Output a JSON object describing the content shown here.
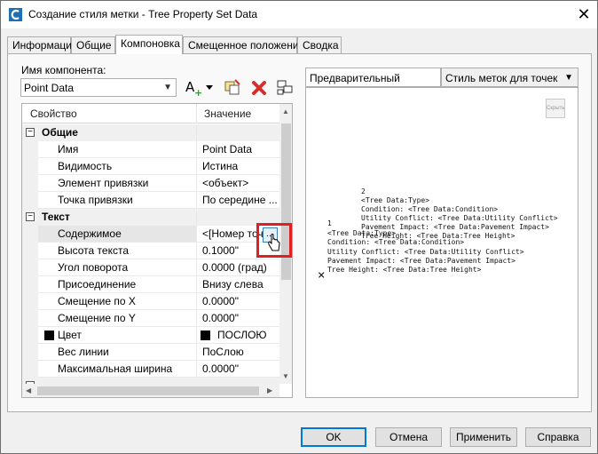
{
  "window": {
    "title": "Создание стиля метки - Tree Property Set Data",
    "close_symbol": "✕"
  },
  "tabs": [
    {
      "label": "Информация",
      "active": false
    },
    {
      "label": "Общие",
      "active": false
    },
    {
      "label": "Компоновка",
      "active": true
    },
    {
      "label": "Смещенное положение",
      "active": false
    },
    {
      "label": "Сводка",
      "active": false
    }
  ],
  "component": {
    "label": "Имя компонента:",
    "value": "Point Data"
  },
  "toolbar_icons": [
    "add-text-component-icon",
    "copy-component-icon",
    "delete-component-icon",
    "component-draw-order-icon"
  ],
  "grid": {
    "col_property": "Свойство",
    "col_value": "Значение",
    "rows": [
      {
        "kind": "category",
        "label": "Общие"
      },
      {
        "kind": "item",
        "label": "Имя",
        "value": "Point Data"
      },
      {
        "kind": "item",
        "label": "Видимость",
        "value": "Истина"
      },
      {
        "kind": "item",
        "label": "Элемент привязки",
        "value": "<объект>"
      },
      {
        "kind": "item",
        "label": "Точка привязки",
        "value": "По середине ..."
      },
      {
        "kind": "category",
        "label": "Текст"
      },
      {
        "kind": "item",
        "label": "Содержимое",
        "value": "<[Номер точ",
        "selected": true
      },
      {
        "kind": "item",
        "label": "Высота текста",
        "value": "0.1000\""
      },
      {
        "kind": "item",
        "label": "Угол поворота",
        "value": "0.0000 (град)"
      },
      {
        "kind": "item",
        "label": "Присоединение",
        "value": "Внизу слева"
      },
      {
        "kind": "item",
        "label": "Смещение по X",
        "value": "0.0000\""
      },
      {
        "kind": "item",
        "label": "Смещение по Y",
        "value": "0.0000\""
      },
      {
        "kind": "item",
        "label": "Цвет",
        "value": "ПОСЛОЮ",
        "swatch": "#000000"
      },
      {
        "kind": "item",
        "label": "Вес линии",
        "value": "ПоСлою"
      },
      {
        "kind": "item",
        "label": "Максимальная ширина",
        "value": "0.0000\""
      }
    ],
    "content_button": "…"
  },
  "preview": {
    "label": "Предварительный просмотр",
    "style_select": "Стиль меток для точек",
    "small_button": "Скрыть",
    "text_lines": [
      "2",
      "<Tree Data:Type>",
      "Condition: <Tree Data:Condition>",
      "Utility Conflict: <Tree Data:Utility Conflict>",
      "Pavement Impact: <Tree Data:Pavement Impact>",
      "Tree Height: <Tree Data:Tree Height>",
      "1",
      "<Tree Data:Type>",
      "Condition: <Tree Data:Condition>",
      "Utility Conflict: <Tree Data:Utility Conflict>",
      "Pavement Impact: <Tree Data:Pavement Impact>",
      "Tree Height: <Tree Data:Tree Height>"
    ],
    "marker": "×"
  },
  "buttons": {
    "ok": "OK",
    "cancel": "Отмена",
    "apply": "Применить",
    "help": "Справка"
  },
  "colors": {
    "accent": "#0078d7",
    "highlight_box": "#e02020",
    "delete_icon": "#d32f2f"
  }
}
